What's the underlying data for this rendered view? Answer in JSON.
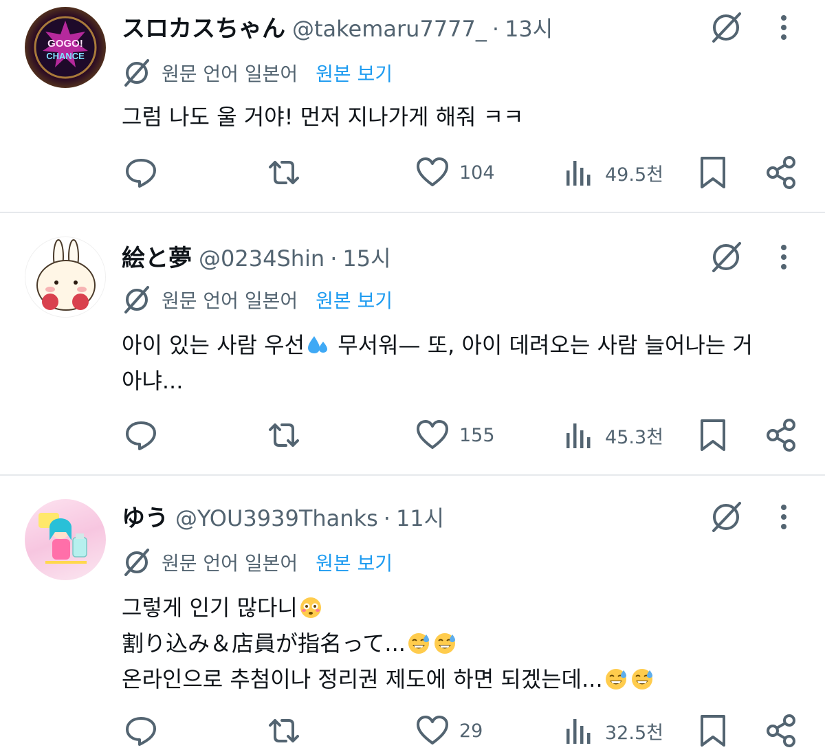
{
  "tweets": [
    {
      "name": "スロカスちゃん",
      "handle": "@takemaru7777_",
      "separator": "·",
      "time": "13시",
      "translation_label": "원문 언어 일본어",
      "translation_link": "원본 보기",
      "lines": [
        "그럼 나도 울 거야! 먼저 지나가게 해줘 ㅋㅋ"
      ],
      "likes": "104",
      "views": "49.5천",
      "avatar_text": "GOGO! CHANCE"
    },
    {
      "name": "絵と夢",
      "handle": "@0234Shin",
      "separator": "·",
      "time": "15시",
      "translation_label": "원문 언어 일본어",
      "translation_link": "원본 보기",
      "lines": [
        "아이 있는 사람 우선",
        "무서워— 또, 아이 데려오는 사람 늘어나는 거",
        "아냐..."
      ],
      "likes": "155",
      "views": "45.3천"
    },
    {
      "name": "ゆう",
      "handle": "@YOU3939Thanks",
      "separator": "·",
      "time": "11시",
      "translation_label": "원문 언어 일본어",
      "translation_link": "원본 보기",
      "lines": [
        "그렇게 인기 많다니",
        "割り込み＆店員が指名って...",
        "온라인으로 추첨이나 정리권 제도에 하면 되겠는데..."
      ],
      "likes": "29",
      "views": "32.5천"
    }
  ],
  "icons": {
    "reply": "reply-icon",
    "retweet": "retweet-icon",
    "like": "heart-icon",
    "views": "views-icon",
    "bookmark": "bookmark-icon",
    "share": "share-icon",
    "grok": "grok-icon",
    "more": "more-icon",
    "translate": "translate-icon"
  },
  "colors": {
    "text": "#0f1419",
    "secondary": "#536471",
    "link": "#1d9bf0",
    "divider": "#e6e9ec"
  }
}
